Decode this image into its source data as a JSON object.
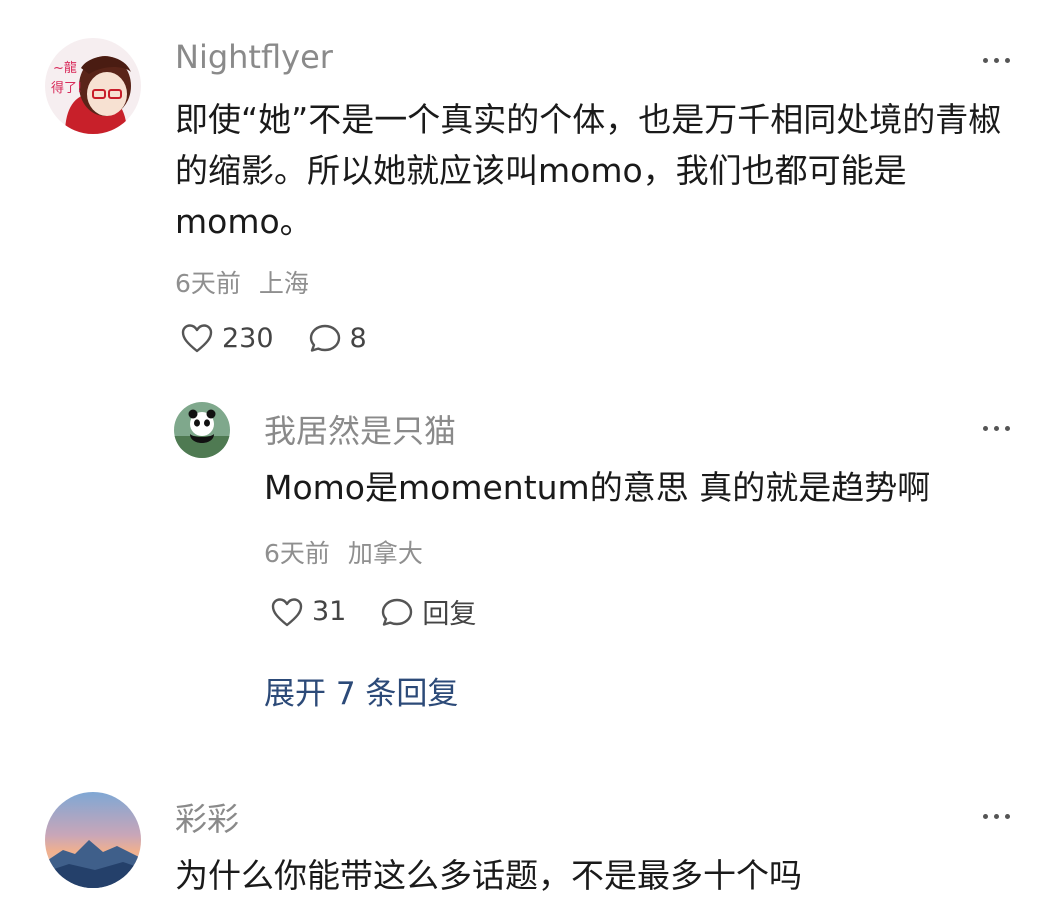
{
  "comments": [
    {
      "username": "Nightflyer",
      "avatar_icon": "anime-girl-avatar",
      "text": "即使“她”不是一个真实的个体，也是万千相同处境的青椒的缩影。所以她就应该叫momo，我们也都可能是momo。",
      "time": "6天前",
      "location": "上海",
      "likes": "230",
      "replies": "8",
      "sub_reply": {
        "username": "我居然是只猫",
        "avatar_icon": "panda-avatar",
        "text": "Momo是momentum的意思 真的就是趋势啊",
        "time": "6天前",
        "location": "加拿大",
        "likes": "31",
        "reply_label": "回复"
      },
      "expand_label": "展开 7 条回复"
    },
    {
      "username": "彩彩",
      "avatar_icon": "mountain-sunset-avatar",
      "text": "为什么你能带这么多话题，不是最多十个吗"
    }
  ]
}
